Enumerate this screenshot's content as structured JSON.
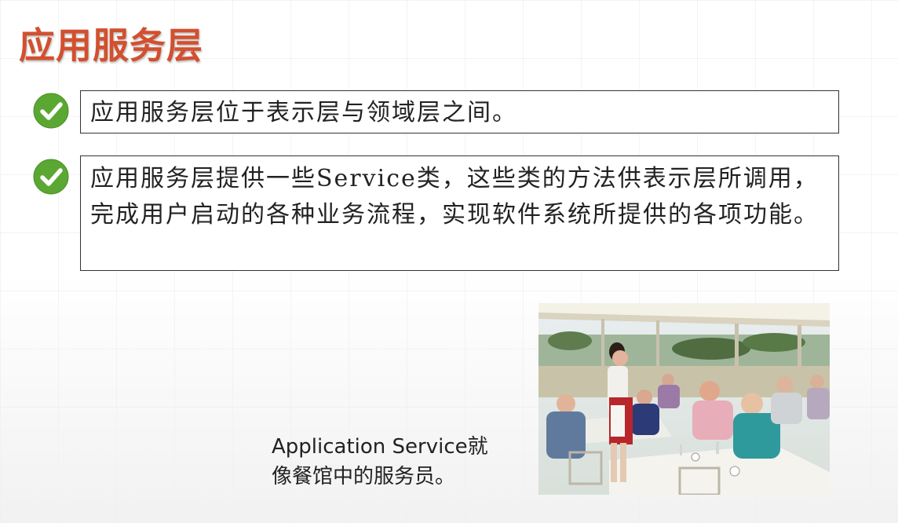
{
  "slide": {
    "title": "应用服务层",
    "bullets": [
      {
        "icon": "check-icon",
        "text": "应用服务层位于表示层与领域层之间。"
      },
      {
        "icon": "check-icon",
        "text": "应用服务层提供一些Service类，这些类的方法供表示层所调用，完成用户启动的各种业务流程，实现软件系统所提供的各项功能。"
      }
    ],
    "caption": "Application Service就像餐馆中的服务员。"
  },
  "colors": {
    "title": "#d2502f",
    "check": "#5aa832"
  }
}
